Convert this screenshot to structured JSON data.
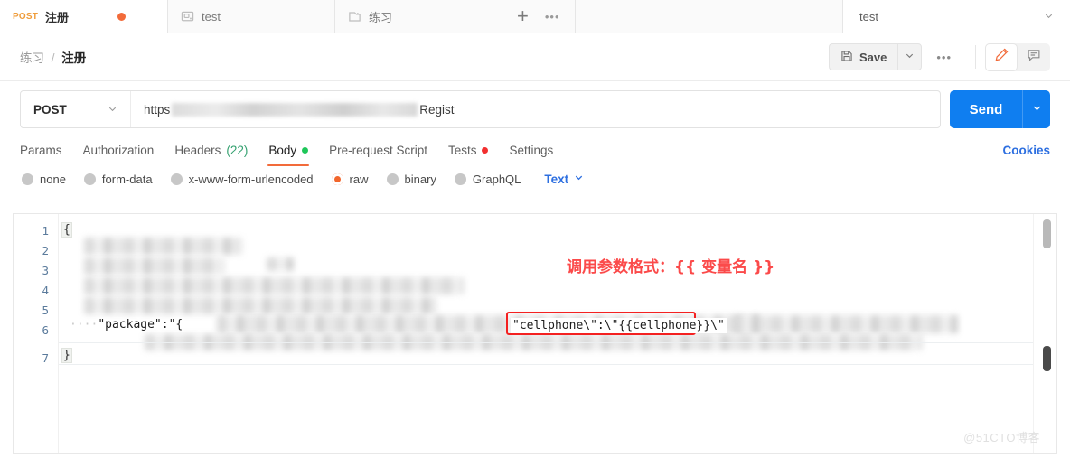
{
  "window": {
    "tabs": [
      {
        "method": "POST",
        "title": "注册",
        "unsaved": true,
        "icon": "",
        "active": true
      },
      {
        "method": "",
        "title": "test",
        "unsaved": false,
        "icon": "monitor-icon",
        "active": false
      },
      {
        "method": "",
        "title": "练习",
        "unsaved": false,
        "icon": "folder-icon",
        "active": false
      }
    ],
    "new_tab_label": "+",
    "tab_overflow_label": "•••",
    "environment": {
      "value": "test",
      "caret": "chevron-down-icon"
    }
  },
  "breadcrumb": {
    "collection": "练习",
    "separator": "/",
    "request": "注册"
  },
  "toolbar": {
    "save_label": "Save",
    "save_icon": "floppy-disk-icon",
    "save_caret": "chevron-down-icon",
    "more_label": "•••",
    "edit_icon": "pencil-icon",
    "comment_icon": "comment-icon"
  },
  "request": {
    "method": "POST",
    "method_caret": "chevron-down-icon",
    "url_prefix": "https",
    "url_suffix": "Regist",
    "url_redacted": true,
    "send_label": "Send",
    "send_caret": "chevron-down-icon"
  },
  "request_tabs": {
    "items": [
      {
        "label": "Params",
        "count": "",
        "dot": "",
        "active": false
      },
      {
        "label": "Authorization",
        "count": "",
        "dot": "",
        "active": false
      },
      {
        "label": "Headers",
        "count": "(22)",
        "dot": "",
        "active": false
      },
      {
        "label": "Body",
        "count": "",
        "dot": "green",
        "active": true
      },
      {
        "label": "Pre-request Script",
        "count": "",
        "dot": "",
        "active": false
      },
      {
        "label": "Tests",
        "count": "",
        "dot": "red",
        "active": false
      },
      {
        "label": "Settings",
        "count": "",
        "dot": "",
        "active": false
      }
    ],
    "cookies_label": "Cookies"
  },
  "body_options": {
    "items": [
      {
        "label": "none",
        "selected": false
      },
      {
        "label": "form-data",
        "selected": false
      },
      {
        "label": "x-www-form-urlencoded",
        "selected": false
      },
      {
        "label": "raw",
        "selected": true
      },
      {
        "label": "binary",
        "selected": false
      },
      {
        "label": "GraphQL",
        "selected": false
      }
    ],
    "format": {
      "label": "Text",
      "caret": "chevron-down-icon"
    }
  },
  "editor": {
    "line_numbers": [
      "1",
      "2",
      "3",
      "4",
      "5",
      "6",
      "7"
    ],
    "line1_text": "{",
    "line6_text": "\"package\":\"{",
    "line7_text": "}",
    "highlighted_snippet": "\"cellphone\\\":\\\"{{cellphone}}\\\"",
    "annotation": "调用参数格式：{{ 变量名 }}",
    "annotation_color": "#fb4a4a",
    "highlight_box_color": "#f42121",
    "redacted_content": true
  },
  "watermark": "@51CTO博客"
}
